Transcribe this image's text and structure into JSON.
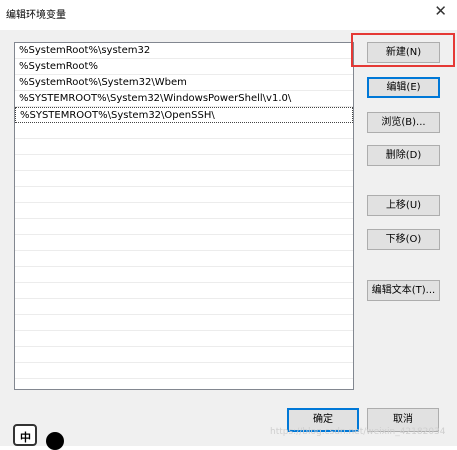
{
  "window": {
    "title": "编辑环境变量",
    "close_glyph": "✕"
  },
  "paths": [
    "%SystemRoot%\\system32",
    "%SystemRoot%",
    "%SystemRoot%\\System32\\Wbem",
    "%SYSTEMROOT%\\System32\\WindowsPowerShell\\v1.0\\",
    "%SYSTEMROOT%\\System32\\OpenSSH\\"
  ],
  "buttons": {
    "new": "新建(N)",
    "edit": "编辑(E)",
    "browse": "浏览(B)...",
    "delete": "删除(D)",
    "move_up": "上移(U)",
    "move_down": "下移(O)",
    "edit_text": "编辑文本(T)...",
    "ok": "确定",
    "cancel": "取消"
  },
  "ime": {
    "label": "中"
  },
  "watermark": "https://blog.csdn.net/weixin_42182034",
  "colors": {
    "highlight": "#e53935",
    "default_button_border": "#0078d7"
  }
}
